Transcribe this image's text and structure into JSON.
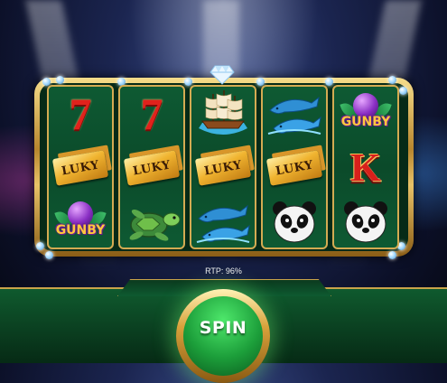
{
  "game": {
    "rtp_label": "RTP: 96%",
    "spin_label": "SPIN",
    "symbols": {
      "seven": "7",
      "luky": "LUKY",
      "gunby": "GUNBY",
      "k": "K"
    }
  },
  "reels": [
    [
      "seven",
      "luky",
      "gunby"
    ],
    [
      "seven",
      "luky",
      "turtle"
    ],
    [
      "ship",
      "luky",
      "dolphins"
    ],
    [
      "dolphins",
      "luky",
      "panda"
    ],
    [
      "gunby",
      "k",
      "panda"
    ]
  ],
  "colors": {
    "reel_bg": "#0b4a2a",
    "gold": "#d4ab52",
    "spin_green": "#1c9e3a"
  }
}
